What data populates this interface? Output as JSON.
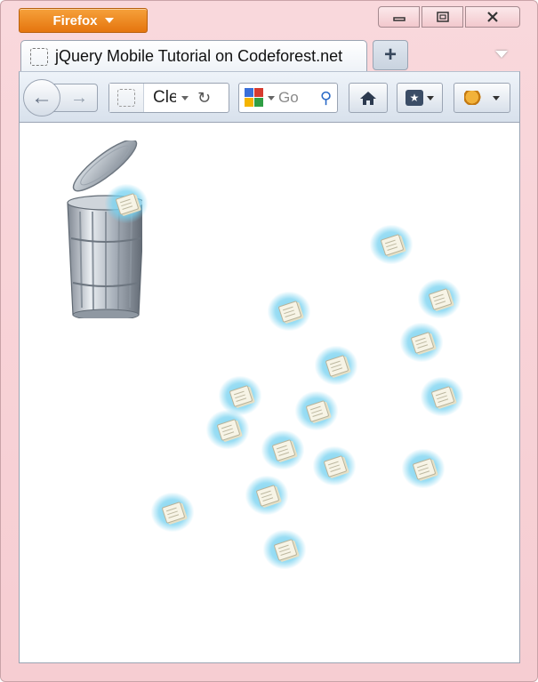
{
  "window": {
    "menu_button_label": "Firefox",
    "controls": {
      "minimize": "▭",
      "maximize": "▢",
      "close": "✕"
    }
  },
  "tab": {
    "title": "jQuery Mobile Tutorial on Codeforest.net",
    "new_tab_label": "+"
  },
  "toolbar": {
    "back_glyph": "←",
    "forward_glyph": "→",
    "url_text": "Cle",
    "reload_glyph": "↻",
    "search_placeholder": "Go",
    "search_icon": "⚲",
    "home_glyph": "⌂",
    "bookmarks_glyph": "★"
  },
  "icons": {
    "trash": "trash-can-icon",
    "tile": "draggable-paper-tile"
  },
  "colors": {
    "frame": "#f6cdd2",
    "firefox_button": "#e5750e",
    "tile_glow": "#78d2f0"
  }
}
